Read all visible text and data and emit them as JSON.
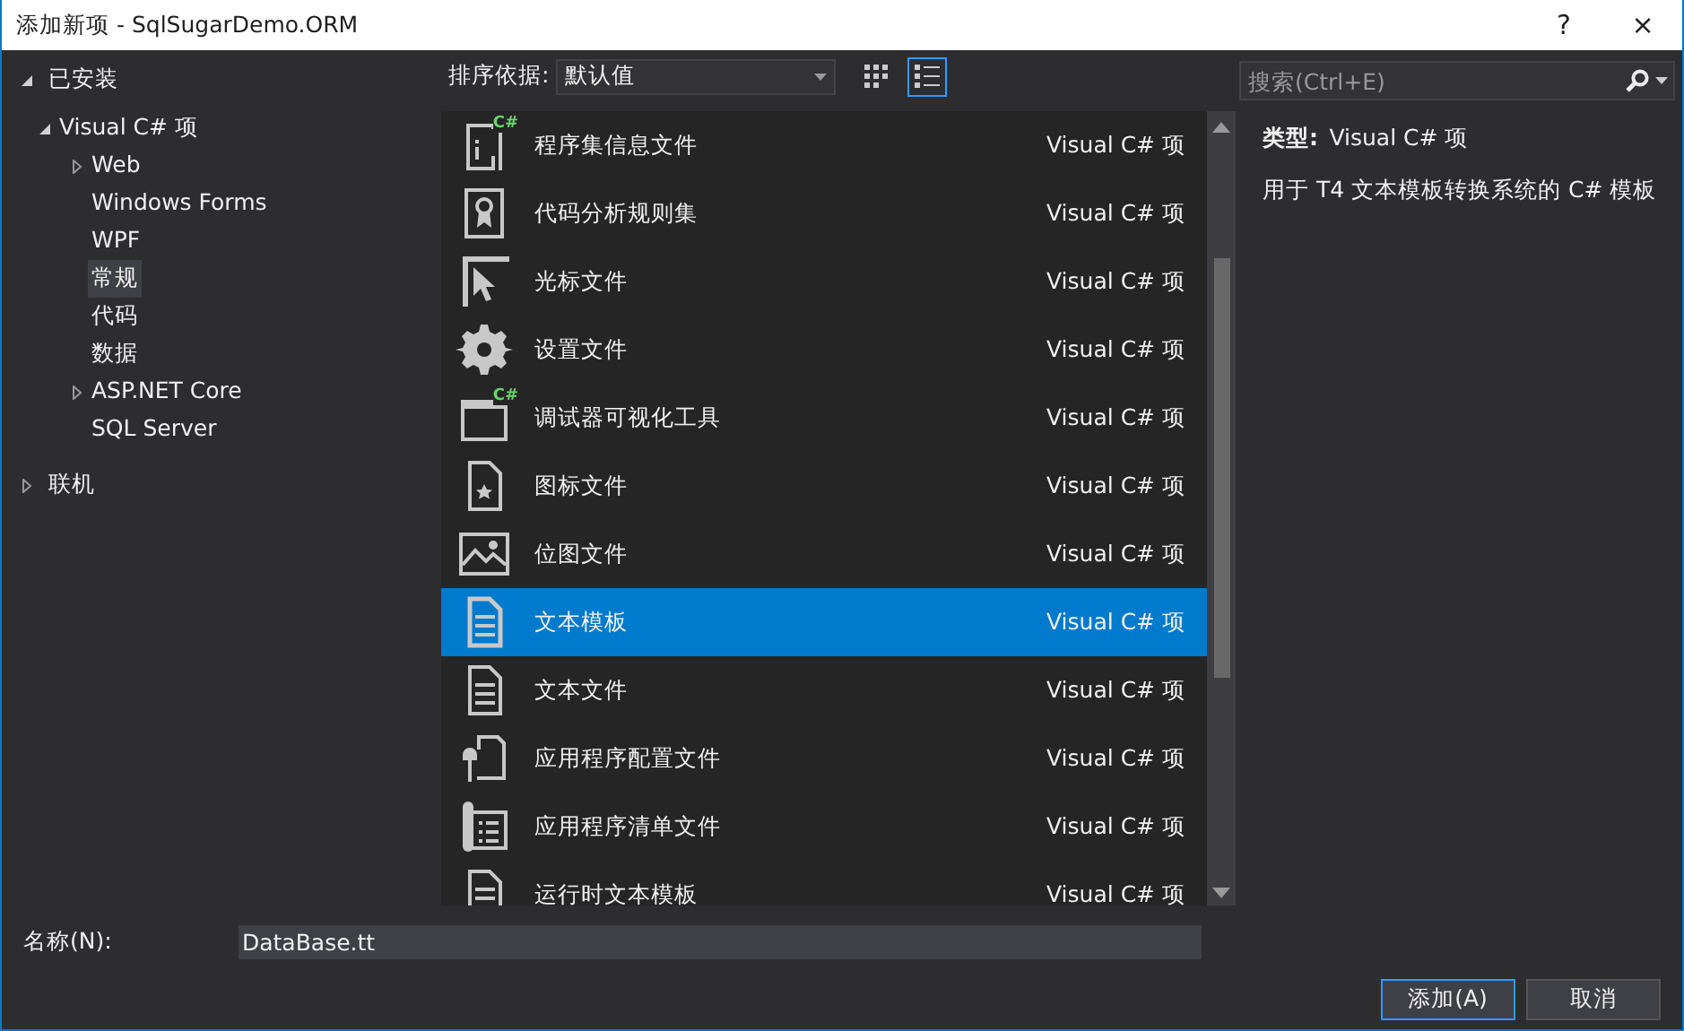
{
  "window": {
    "title": "添加新项 - SqlSugarDemo.ORM",
    "help": "?",
    "close": "×"
  },
  "tree": [
    {
      "label": "已安装",
      "kind": "folder",
      "expanded": true,
      "selected": false,
      "children": [
        {
          "label": "Visual C# 项",
          "kind": "folder",
          "expanded": true,
          "selected": false,
          "children": [
            {
              "label": "Web",
              "kind": "folder",
              "expanded": false,
              "selected": false
            },
            {
              "label": "Windows Forms",
              "kind": "leaf",
              "selected": false
            },
            {
              "label": "WPF",
              "kind": "leaf",
              "selected": false
            },
            {
              "label": "常规",
              "kind": "leaf",
              "selected": true
            },
            {
              "label": "代码",
              "kind": "leaf",
              "selected": false
            },
            {
              "label": "数据",
              "kind": "leaf",
              "selected": false
            },
            {
              "label": "ASP.NET Core",
              "kind": "folder",
              "expanded": false,
              "selected": false
            },
            {
              "label": "SQL Server",
              "kind": "leaf",
              "selected": false
            }
          ]
        }
      ]
    },
    {
      "label": "联机",
      "kind": "folder",
      "expanded": false,
      "selected": false
    }
  ],
  "sort": {
    "label": "排序依据:",
    "value": "默认值"
  },
  "view_buttons": [
    {
      "selected": false
    },
    {
      "selected": true
    }
  ],
  "search": {
    "placeholder": "搜索(Ctrl+E)"
  },
  "templates": [
    {
      "name": "程序集信息文件",
      "type": "Visual C# 项",
      "badge": "C#",
      "selected": false
    },
    {
      "name": "代码分析规则集",
      "type": "Visual C# 项",
      "selected": false
    },
    {
      "name": "光标文件",
      "type": "Visual C# 项",
      "selected": false
    },
    {
      "name": "设置文件",
      "type": "Visual C# 项",
      "selected": false
    },
    {
      "name": "调试器可视化工具",
      "type": "Visual C# 项",
      "badge": "C#",
      "selected": false
    },
    {
      "name": "图标文件",
      "type": "Visual C# 项",
      "selected": false
    },
    {
      "name": "位图文件",
      "type": "Visual C# 项",
      "selected": false
    },
    {
      "name": "文本模板",
      "type": "Visual C# 项",
      "selected": true
    },
    {
      "name": "文本文件",
      "type": "Visual C# 项",
      "selected": false
    },
    {
      "name": "应用程序配置文件",
      "type": "Visual C# 项",
      "selected": false
    },
    {
      "name": "应用程序清单文件",
      "type": "Visual C# 项",
      "selected": false
    },
    {
      "name": "运行时文本模板",
      "type": "Visual C# 项",
      "selected": false
    }
  ],
  "details": {
    "type_label": "类型:",
    "type_value": "Visual C# 项",
    "description": "用于 T4 文本模板转换系统的 C# 模板"
  },
  "name_field": {
    "label": "名称(N):",
    "value": "DataBase.tt"
  },
  "buttons": [
    {
      "label": "添加(A)",
      "default": true
    },
    {
      "label": "取消",
      "default": false
    }
  ]
}
